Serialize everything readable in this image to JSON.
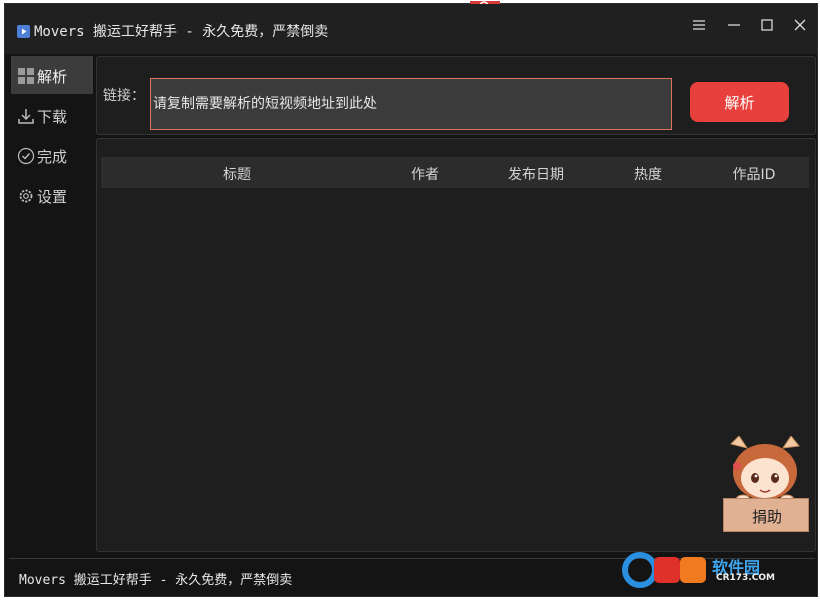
{
  "window": {
    "title": "Movers 搬运工好帮手 - 永久免费，严禁倒卖"
  },
  "sidebar": {
    "items": [
      {
        "label": "解析",
        "icon": "grid-icon",
        "active": true
      },
      {
        "label": "下载",
        "icon": "download-icon",
        "active": false
      },
      {
        "label": "完成",
        "icon": "check-circle-icon",
        "active": false
      },
      {
        "label": "设置",
        "icon": "gear-icon",
        "active": false
      }
    ]
  },
  "input": {
    "label": "链接：",
    "placeholder": "请复制需要解析的短视频地址到此处",
    "value": ""
  },
  "parse_button": {
    "label": "解析"
  },
  "table": {
    "columns": [
      "标题",
      "作者",
      "发布日期",
      "热度",
      "作品ID"
    ],
    "rows": []
  },
  "status_bar": {
    "text": "Movers 搬运工好帮手 - 永久免费，严禁倒卖"
  },
  "donate": {
    "label": "捐助"
  },
  "watermark": {
    "brand": "软件园",
    "domain": "CR173.COM"
  },
  "colors": {
    "accent": "#e8413d",
    "input_border": "#d9775c",
    "background": "#141414",
    "panel": "#1e1e1e",
    "active_nav": "#3c3c3c"
  }
}
